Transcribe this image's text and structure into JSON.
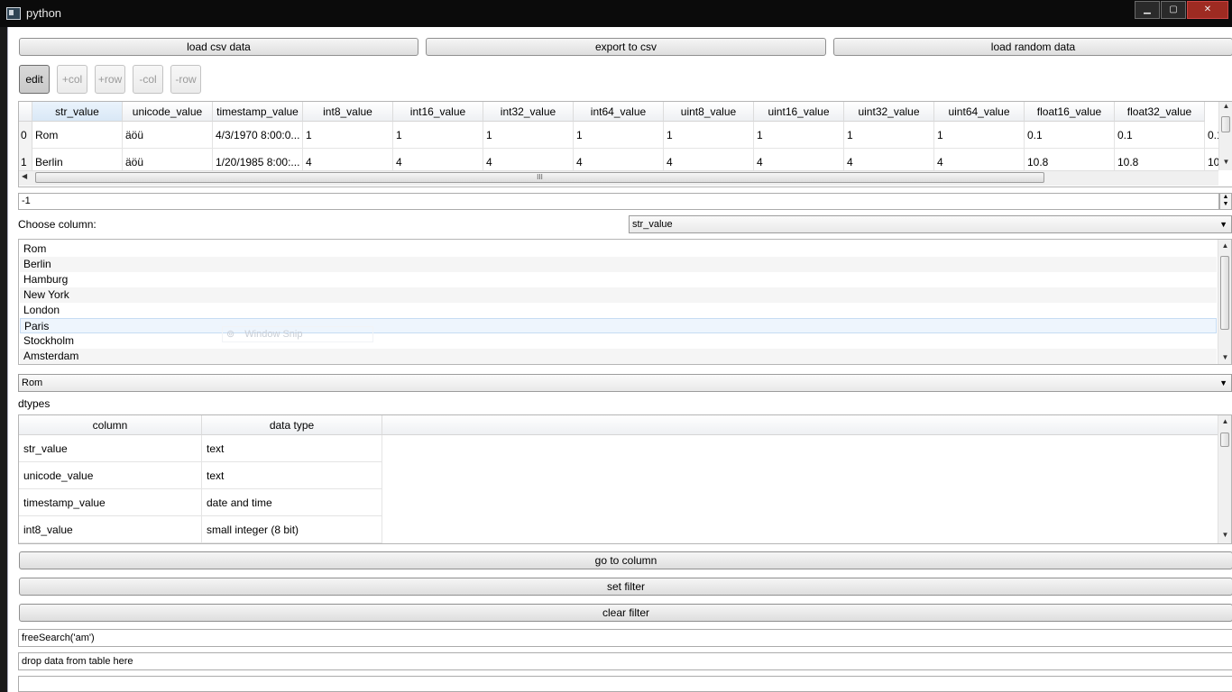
{
  "window": {
    "title": "python"
  },
  "toolbar": {
    "load_csv": "load csv data",
    "export_csv": "export to csv",
    "load_random": "load random data",
    "edit": "edit",
    "add_col": "+col",
    "add_row": "+row",
    "remove_col": "-col",
    "remove_row": "-row"
  },
  "table": {
    "columns": [
      "str_value",
      "unicode_value",
      "timestamp_value",
      "int8_value",
      "int16_value",
      "int32_value",
      "int64_value",
      "uint8_value",
      "uint16_value",
      "uint32_value",
      "uint64_value",
      "float16_value",
      "float32_value"
    ],
    "rows": [
      {
        "index": "0",
        "cells": [
          "Rom",
          "äöü",
          "4/3/1970 8:00:0...",
          "1",
          "1",
          "1",
          "1",
          "1",
          "1",
          "1",
          "1",
          "0.1",
          "0.1"
        ],
        "overflow": "0.1"
      },
      {
        "index": "1",
        "cells": [
          "Berlin",
          "äöü",
          "1/20/1985 8:00:...",
          "4",
          "4",
          "4",
          "4",
          "4",
          "4",
          "4",
          "4",
          "10.8",
          "10.8"
        ],
        "overflow": "10"
      }
    ],
    "hscroll_grip": "III"
  },
  "spinbox": {
    "value": "-1"
  },
  "choose_column": {
    "label": "Choose column:",
    "selected": "str_value"
  },
  "values_list": {
    "items": [
      "Rom",
      "Berlin",
      "Hamburg",
      "New York",
      "London",
      "Paris",
      "Stockholm",
      "Amsterdam"
    ],
    "selected_index": 5
  },
  "overlay": {
    "text": "Window Snip"
  },
  "value_combo": {
    "selected": "Rom"
  },
  "dtypes": {
    "label": "dtypes",
    "headers": [
      "column",
      "data type"
    ],
    "rows": [
      [
        "str_value",
        "text"
      ],
      [
        "unicode_value",
        "text"
      ],
      [
        "timestamp_value",
        "date and time"
      ],
      [
        "int8_value",
        "small integer (8 bit)"
      ]
    ]
  },
  "actions": {
    "goto_column": "go to column",
    "set_filter": "set filter",
    "clear_filter": "clear filter"
  },
  "search": {
    "value": "freeSearch('am')"
  },
  "drop": {
    "value": "drop data from table here"
  }
}
